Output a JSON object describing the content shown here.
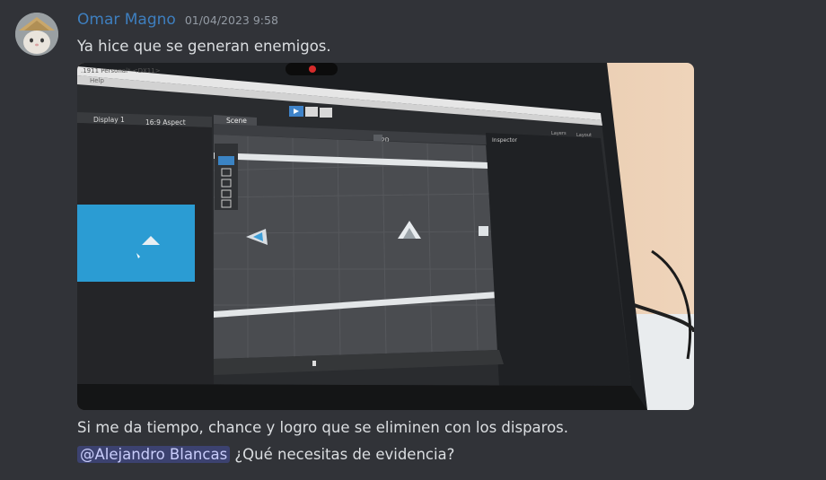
{
  "message": {
    "author": "Omar Magno",
    "timestamp": "01/04/2023 9:58",
    "text": "Ya hice que se generan enemigos.",
    "attachment": {
      "screen": {
        "title": ".1911 Personal* <DX11>",
        "menu": "Help",
        "display_label": "Display 1",
        "aspect_label": "16:9 Aspect",
        "scene_tab": "Scene",
        "inspector_tab": "Inspector",
        "layers_label": "Layers",
        "layout_label": "Layout",
        "scene_mode": "2D"
      }
    }
  },
  "followups": [
    {
      "text": "Si me da tiempo, chance y logro que se eliminen con los disparos."
    },
    {
      "mention": "@Alejandro Blancas",
      "text": " ¿Qué necesitas de evidencia?"
    }
  ]
}
